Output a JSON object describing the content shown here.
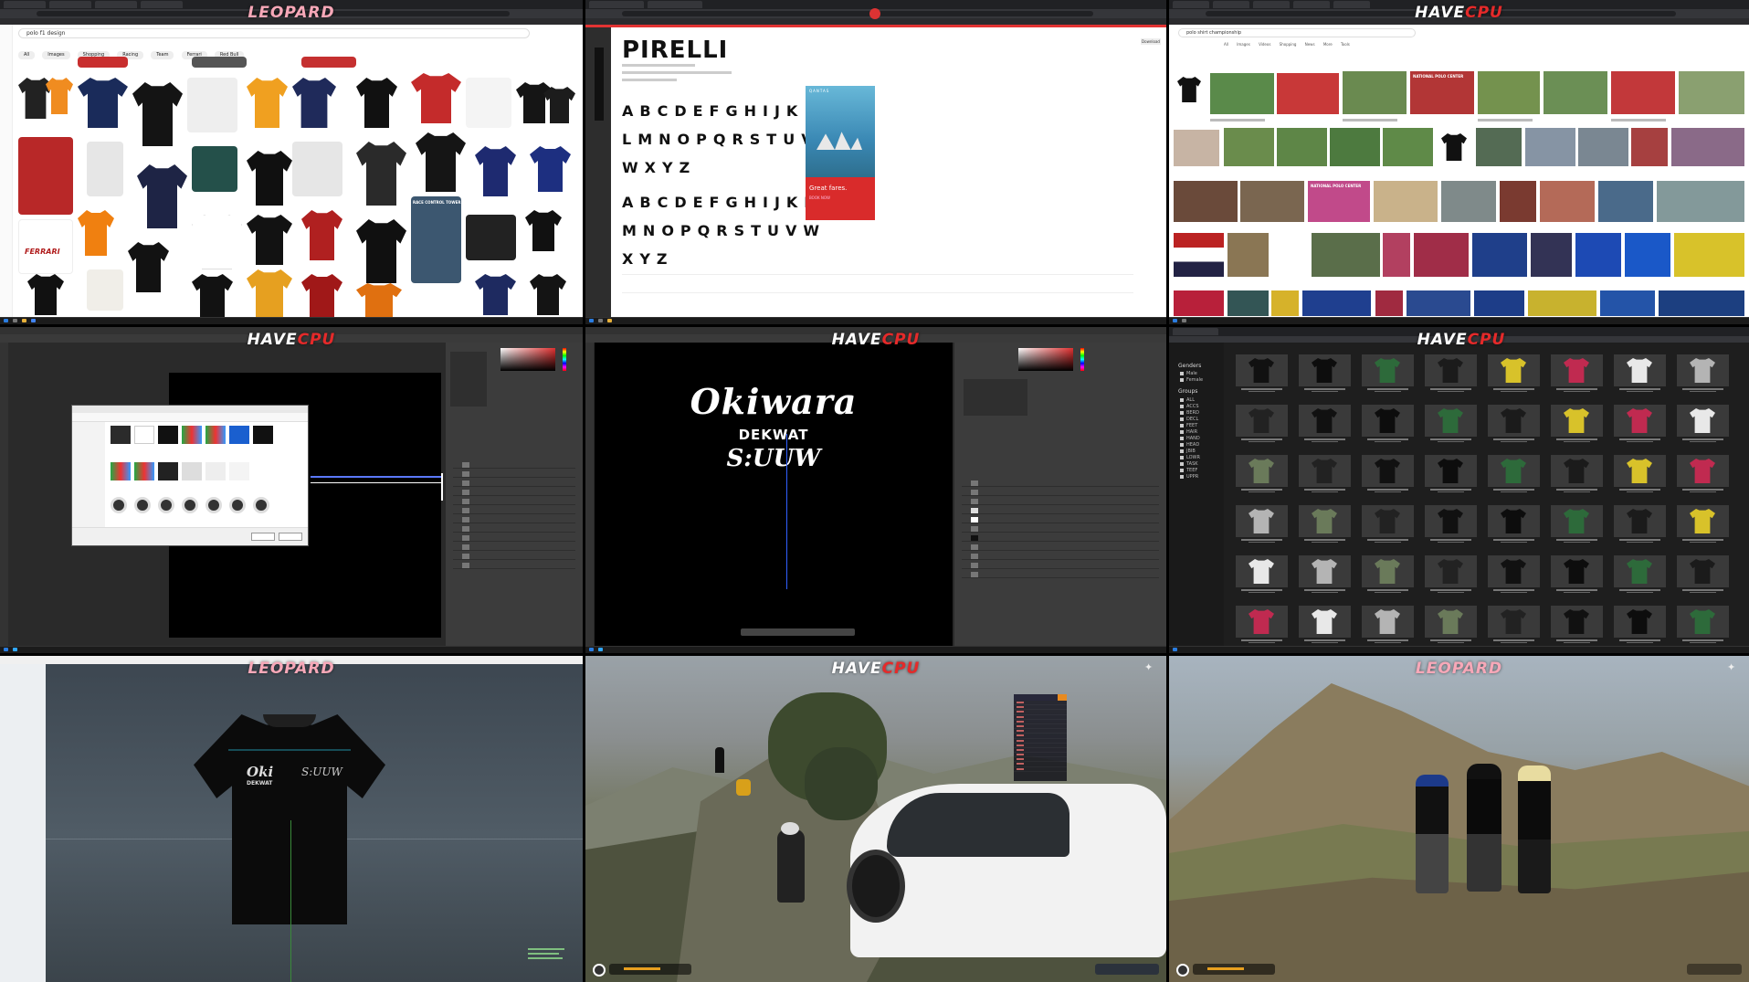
{
  "overlay": {
    "brand_havecpu_1": "HAVE",
    "brand_havecpu_2": "CPU",
    "brand_leopard": "LEOPARD"
  },
  "panel1": {
    "search_text": "polo f1 design",
    "chips": [
      "All",
      "Images",
      "Shopping",
      "Racing",
      "Team",
      "Ferrari",
      "Red Bull"
    ],
    "thumb_caption_ferrari": "FERRARI",
    "thumb_caption_race": "RACE CONTROL TOWER"
  },
  "panel2": {
    "font_title": "PIRELLI",
    "download_label": "Download",
    "glyphs_row1": "ABCDEFGHIJK",
    "glyphs_row2": "LMNOPQRSTUV",
    "glyphs_row3": "WXYZ",
    "glyphs_row4": "ABCDEFGHIJKL",
    "glyphs_row5": "MNOPQRSTUVW",
    "glyphs_row6": "XYZ",
    "ad_brand": "QANTAS",
    "ad_headline": "Great fares.",
    "ad_cta": "BOOK NOW"
  },
  "panel3": {
    "search_text": "polo shirt championship",
    "tabs": "All Images Videos Shopping News More Tools",
    "banner_1": "NATIONAL POLO CENTER",
    "banner_2": "NATIONAL POLO CENTER"
  },
  "panel5": {
    "design_line1": "Okiwara",
    "design_line2": "DEKWAT",
    "design_line3": "S:UUW"
  },
  "panel6": {
    "genders_label": "Genders",
    "gender_options": [
      "Male",
      "Female"
    ],
    "groups_label": "Groups",
    "group_options": [
      "ALL",
      "ACCS",
      "BERD",
      "DECL",
      "FEET",
      "HAIR",
      "HAND",
      "HEAD",
      "JBIB",
      "LOWR",
      "TASK",
      "TEEF",
      "UPPR"
    ]
  },
  "panel7": {
    "shirt_line1": "Oki",
    "shirt_line2": "DEKWAT",
    "shirt_line3": "S:UUW"
  },
  "colors": {
    "brand_red": "#e52a2a",
    "ad_red": "#d92b2b",
    "hud_orange": "#e8a020"
  }
}
